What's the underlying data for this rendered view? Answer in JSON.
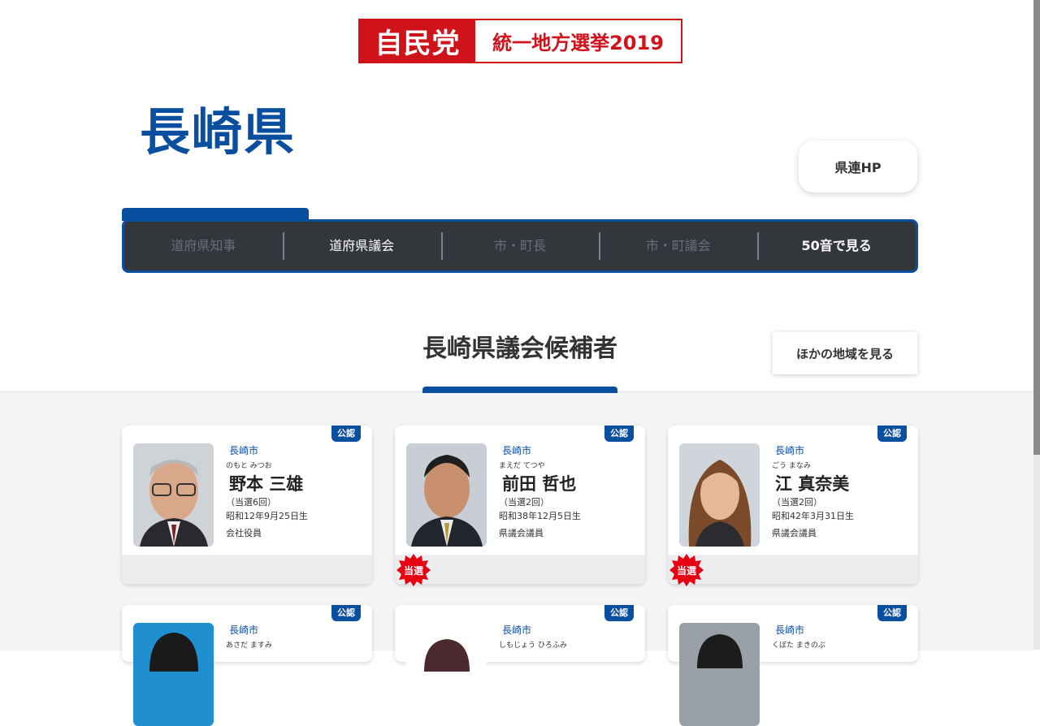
{
  "logo": {
    "party": "自民党",
    "election": "統一地方選挙2019"
  },
  "prefecture": "長崎県",
  "hp_button": "県連HP",
  "tabs": [
    {
      "label": "道府県知事"
    },
    {
      "label": "道府県議会"
    },
    {
      "label": "市・町長"
    },
    {
      "label": "市・町議会"
    },
    {
      "label": "50音で見る"
    }
  ],
  "section_title": "長崎県議会候補者",
  "other_regions_button": "ほかの地域を見る",
  "colors": {
    "accent_blue": "#0a4ea0",
    "party_red": "#d0121b",
    "tab_bg": "#33363b"
  },
  "candidates": [
    {
      "badge": "公認",
      "city": "長崎市",
      "kana": "のもと みつお",
      "name": "野本 三雄",
      "terms": "（当選6回）",
      "birth": "昭和12年9月25日生",
      "job": "会社役員",
      "elected": ""
    },
    {
      "badge": "公認",
      "city": "長崎市",
      "kana": "まえだ てつや",
      "name": "前田 哲也",
      "terms": "（当選2回）",
      "birth": "昭和38年12月5日生",
      "job": "県議会議員",
      "elected": "当選"
    },
    {
      "badge": "公認",
      "city": "長崎市",
      "kana": "ごう まなみ",
      "name": "江 真奈美",
      "terms": "（当選2回）",
      "birth": "昭和42年3月31日生",
      "job": "県議会議員",
      "elected": "当選"
    },
    {
      "badge": "公認",
      "city": "長崎市",
      "kana": "あさだ ますみ"
    },
    {
      "badge": "公認",
      "city": "長崎市",
      "kana": "しもじょう ひろふみ"
    },
    {
      "badge": "公認",
      "city": "長崎市",
      "kana": "くぼた まきのぶ"
    }
  ]
}
